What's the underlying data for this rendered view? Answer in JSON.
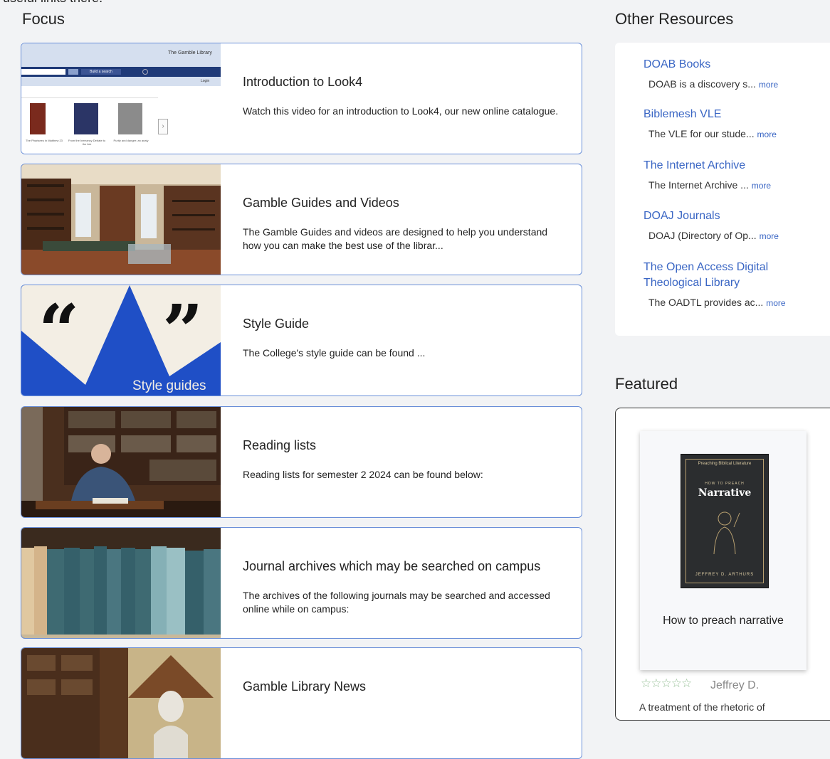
{
  "top_clip": "useful links there.",
  "focus": {
    "title": "Focus",
    "cards": [
      {
        "title": "Introduction to Look4",
        "desc": "Watch this video for an introduction to Look4, our new online catalogue."
      },
      {
        "title": "Gamble Guides and Videos",
        "desc": "The Gamble Guides and videos are designed to help you understand how you can make the best use of the librar..."
      },
      {
        "title": "Style Guide",
        "desc": "The College's style guide can be found ..."
      },
      {
        "title": "Reading lists",
        "desc": "Reading lists for semester 2 2024 can be found below:"
      },
      {
        "title": "Journal archives which may be searched on campus",
        "desc": "The archives of the following journals may be searched and accessed online while on campus:"
      },
      {
        "title": "Gamble Library News",
        "desc": ""
      }
    ],
    "thumb1": {
      "banner": "The Gamble Library",
      "search_btn": "Build a search",
      "login": "Login",
      "books": [
        "The Pharisees in Matthew 23",
        "From the Inerrancy Debate to the Ark",
        "Purity and danger: an analy"
      ]
    },
    "thumb3": {
      "label": "Style guides",
      "quote_open": "“",
      "quote_close": "”"
    }
  },
  "resources": {
    "title": "Other Resources",
    "items": [
      {
        "name": "DOAB Books",
        "desc": "DOAB is a discovery s...",
        "more": "more"
      },
      {
        "name": "Biblemesh VLE",
        "desc": "The VLE for our stude...",
        "more": "more"
      },
      {
        "name": "The Internet Archive",
        "desc": "The Internet Archive ...",
        "more": "more"
      },
      {
        "name": "DOAJ Journals",
        "desc": "DOAJ (Directory of Op...",
        "more": "more"
      },
      {
        "name": "The Open Access Digital Theological Library",
        "desc": "The OADTL provides ac...",
        "more": "more"
      }
    ]
  },
  "featured": {
    "title": "Featured",
    "book_title": "How to preach narrative",
    "cover_series": "Preaching Biblical Literature",
    "cover_howto": "HOW TO PREACH",
    "cover_word": "Narrative",
    "cover_author": "JEFFREY D. ARTHURS",
    "stars": "☆☆☆☆☆",
    "rating": 0,
    "author": "Jeffrey D.",
    "desc": "A treatment of the rhetoric of"
  },
  "colors": {
    "link": "#3a66c4",
    "card_border": "#6a8fd8",
    "star": "#9bc39b"
  }
}
